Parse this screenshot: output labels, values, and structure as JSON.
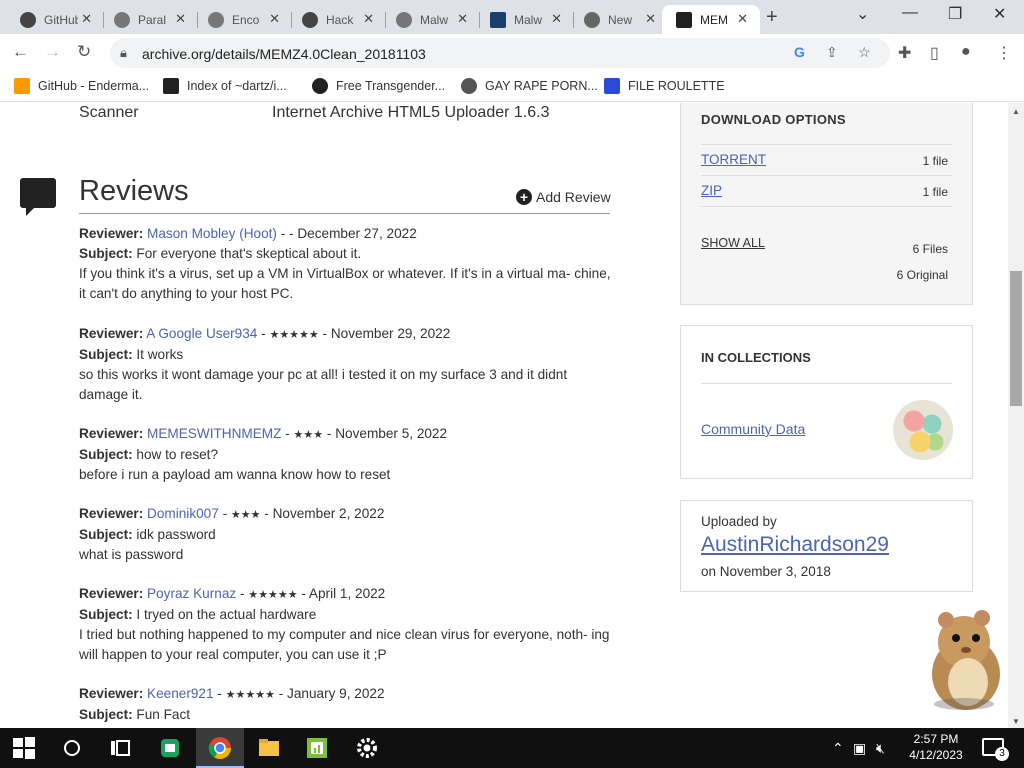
{
  "browser": {
    "tabs": [
      {
        "title": "GitHub"
      },
      {
        "title": "Paral"
      },
      {
        "title": "Enco"
      },
      {
        "title": "Hack"
      },
      {
        "title": "Malw"
      },
      {
        "title": "Malw"
      },
      {
        "title": "New"
      },
      {
        "title": "MEM",
        "active": true
      }
    ],
    "url": "archive.org/details/MEMZ4.0Clean_20181103",
    "bookmarks": [
      {
        "label": "GitHub - Enderma...",
        "color": "#ff9900"
      },
      {
        "label": "Index of ~dartz/i...",
        "color": "#222222"
      },
      {
        "label": "Free Transgender...",
        "color": "#222222"
      },
      {
        "label": "GAY RAPE PORN...",
        "color": "#555555"
      },
      {
        "label": "FILE ROULETTE",
        "color": "#2a4bd7"
      }
    ]
  },
  "metadata": {
    "key": "Scanner",
    "value": "Internet Archive HTML5 Uploader 1.6.3"
  },
  "reviews": {
    "title": "Reviews",
    "add_label": "Add Review",
    "reviewer_label": "Reviewer:",
    "subject_label": "Subject:",
    "items": [
      {
        "reviewer": "Mason Mobley (Hoot)",
        "stars": "",
        "sep": " - - ",
        "date": "December 27, 2022",
        "subject": "For everyone that's skeptical about it.",
        "body": "If you think it's a virus, set up a VM in VirtualBox or whatever. If it's in a virtual ma- chine, it can't do anything to your host PC."
      },
      {
        "reviewer": "A Google User934",
        "stars": "★★★★★",
        "sep": " - ",
        "date": "November 29, 2022",
        "subject": "It works",
        "body": "so this works it wont damage your pc at all! i tested it on my surface 3 and it didnt damage it."
      },
      {
        "reviewer": "MEMESWITHNMEMZ",
        "stars": "★★★",
        "sep": " - ",
        "date": "November 5, 2022",
        "subject": "how to reset?",
        "body": "before i run a payload am wanna know how to reset"
      },
      {
        "reviewer": "Dominik007",
        "stars": "★★★",
        "sep": " - ",
        "date": "November 2, 2022",
        "subject": "idk password",
        "body": "what is password"
      },
      {
        "reviewer": "Poyraz Kurnaz",
        "stars": "★★★★★",
        "sep": " - ",
        "date": "April 1, 2022",
        "subject": "I tryed on the actual hardware",
        "body": "I tried but nothing happened to my computer and nice clean virus for everyone, noth- ing will happen to your real computer, you can use it ;P"
      },
      {
        "reviewer": "Keener921",
        "stars": "★★★★★",
        "sep": " - ",
        "date": "January 9, 2022",
        "subject": "Fun Fact",
        "body": ""
      }
    ]
  },
  "download": {
    "title": "DOWNLOAD OPTIONS",
    "rows": [
      {
        "label": "TORRENT",
        "count": "1 file"
      },
      {
        "label": "ZIP",
        "count": "1 file"
      }
    ],
    "show_all": "SHOW ALL",
    "files": "6 Files",
    "original": "6 Original"
  },
  "collections": {
    "title": "IN COLLECTIONS",
    "item": "Community Data"
  },
  "uploader": {
    "label": "Uploaded by",
    "name": "AustinRichardson29",
    "date": "on November 3, 2018"
  },
  "taskbar": {
    "time": "2:57 PM",
    "date": "4/12/2023",
    "notifications": "3"
  },
  "colors": {
    "link": "#4b64b4",
    "tab_bar": "#dee1e6"
  }
}
